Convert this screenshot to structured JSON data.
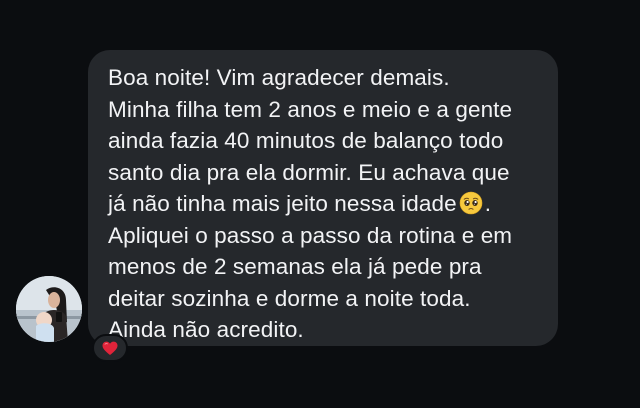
{
  "message": {
    "lines": [
      "Boa noite! Vim agradecer demais.",
      "Minha filha tem 2 anos e meio e a gente",
      "ainda fazia 40 minutos de balanço todo",
      "santo dia pra ela dormir. Eu achava que",
      "já não tinha mais jeito nessa idade",
      "Apliquei o passo a passo da rotina e em",
      "menos de 2 semanas ela já pede pra",
      "deitar sozinha e dorme a noite toda.",
      "Ainda não acredito."
    ],
    "line5_tail": ".",
    "inline_emoji": "pleading-face-icon"
  },
  "reaction": {
    "icon": "red-heart-icon",
    "color": "#e0243a"
  },
  "avatar": {
    "icon": "profile-photo-avatar"
  },
  "colors": {
    "background": "#0b0d10",
    "bubble": "#25282c",
    "text": "#f2f3f5"
  }
}
